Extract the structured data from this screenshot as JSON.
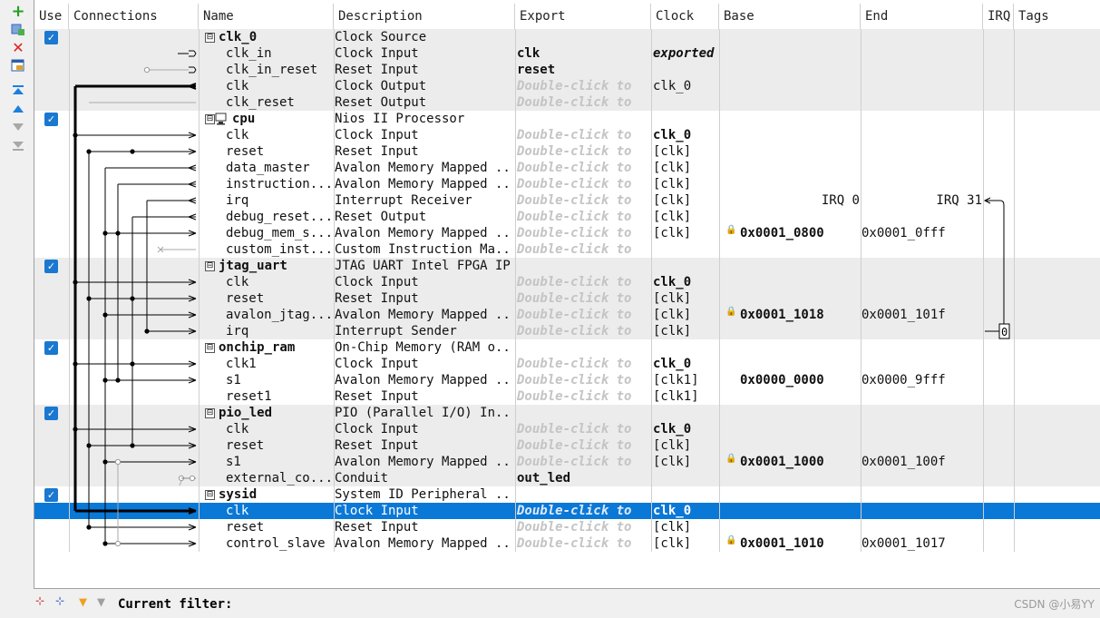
{
  "columns": [
    "Use",
    "Connections",
    "Name",
    "Description",
    "Export",
    "Clock",
    "Base",
    "End",
    "IRQ",
    "Tags"
  ],
  "rows": [
    {
      "kind": "comp",
      "use": true,
      "tree": "⊟",
      "name": "clk_0",
      "desc": "Clock Source",
      "export": "",
      "exportStyle": "",
      "clock": "",
      "clockBold": false,
      "base": "",
      "end": ""
    },
    {
      "kind": "iface",
      "name": "clk_in",
      "desc": "Clock Input",
      "export": "clk",
      "exportStyle": "bold",
      "clock": "exported",
      "clockBold": true,
      "clockItalic": true,
      "base": "",
      "end": ""
    },
    {
      "kind": "iface",
      "name": "clk_in_reset",
      "desc": "Reset Input",
      "export": "reset",
      "exportStyle": "bold",
      "clock": "",
      "clockBold": false,
      "base": "",
      "end": ""
    },
    {
      "kind": "iface",
      "name": "clk",
      "desc": "Clock Output",
      "export": "Double-click to",
      "exportStyle": "hint",
      "clock": "clk_0",
      "clockBold": false,
      "base": "",
      "end": ""
    },
    {
      "kind": "iface",
      "name": "clk_reset",
      "desc": "Reset Output",
      "export": "Double-click to",
      "exportStyle": "hint",
      "clock": "",
      "clockBold": false,
      "base": "",
      "end": ""
    },
    {
      "kind": "comp",
      "use": true,
      "tree": "⊟",
      "icon": true,
      "name": "cpu",
      "desc": "Nios II Processor",
      "export": "",
      "exportStyle": "",
      "clock": "",
      "clockBold": false,
      "base": "",
      "end": ""
    },
    {
      "kind": "iface",
      "name": "clk",
      "desc": "Clock Input",
      "export": "Double-click to",
      "exportStyle": "hint",
      "clock": "clk_0",
      "clockBold": true,
      "base": "",
      "end": ""
    },
    {
      "kind": "iface",
      "name": "reset",
      "desc": "Reset Input",
      "export": "Double-click to",
      "exportStyle": "hint",
      "clock": "[clk]",
      "clockBold": false,
      "base": "",
      "end": ""
    },
    {
      "kind": "iface",
      "name": "data_master",
      "desc": "Avalon Memory Mapped ...",
      "export": "Double-click to",
      "exportStyle": "hint",
      "clock": "[clk]",
      "clockBold": false,
      "base": "",
      "end": ""
    },
    {
      "kind": "iface",
      "name": "instruction...",
      "desc": "Avalon Memory Mapped ...",
      "export": "Double-click to",
      "exportStyle": "hint",
      "clock": "[clk]",
      "clockBold": false,
      "base": "",
      "end": ""
    },
    {
      "kind": "iface",
      "name": "irq",
      "desc": "Interrupt Receiver",
      "export": "Double-click to",
      "exportStyle": "hint",
      "clock": "[clk]",
      "clockBold": false,
      "base": "IRQ 0",
      "baseRight": true,
      "end": "IRQ 31",
      "endRight": true
    },
    {
      "kind": "iface",
      "name": "debug_reset...",
      "desc": "Reset Output",
      "export": "Double-click to",
      "exportStyle": "hint",
      "clock": "[clk]",
      "clockBold": false,
      "base": "",
      "end": ""
    },
    {
      "kind": "iface",
      "name": "debug_mem_s...",
      "desc": "Avalon Memory Mapped ...",
      "export": "Double-click to",
      "exportStyle": "hint",
      "clock": "[clk]",
      "clockBold": false,
      "base": "0x0001_0800",
      "end": "0x0001_0fff",
      "lock": true
    },
    {
      "kind": "iface",
      "name": "custom_inst...",
      "desc": "Custom Instruction Ma...",
      "export": "Double-click to",
      "exportStyle": "hint",
      "clock": "",
      "clockBold": false,
      "base": "",
      "end": ""
    },
    {
      "kind": "comp",
      "use": true,
      "tree": "⊟",
      "name": "jtag_uart",
      "desc": "JTAG UART Intel FPGA IP",
      "export": "",
      "exportStyle": "",
      "clock": "",
      "clockBold": false,
      "base": "",
      "end": ""
    },
    {
      "kind": "iface",
      "name": "clk",
      "desc": "Clock Input",
      "export": "Double-click to",
      "exportStyle": "hint",
      "clock": "clk_0",
      "clockBold": true,
      "base": "",
      "end": ""
    },
    {
      "kind": "iface",
      "name": "reset",
      "desc": "Reset Input",
      "export": "Double-click to",
      "exportStyle": "hint",
      "clock": "[clk]",
      "clockBold": false,
      "base": "",
      "end": ""
    },
    {
      "kind": "iface",
      "name": "avalon_jtag...",
      "desc": "Avalon Memory Mapped ...",
      "export": "Double-click to",
      "exportStyle": "hint",
      "clock": "[clk]",
      "clockBold": false,
      "base": "0x0001_1018",
      "end": "0x0001_101f",
      "lock": true
    },
    {
      "kind": "iface",
      "name": "irq",
      "desc": "Interrupt Sender",
      "export": "Double-click to",
      "exportStyle": "hint",
      "clock": "[clk]",
      "clockBold": false,
      "base": "",
      "end": ""
    },
    {
      "kind": "comp",
      "use": true,
      "tree": "⊟",
      "name": "onchip_ram",
      "desc": "On-Chip Memory (RAM o...",
      "export": "",
      "exportStyle": "",
      "clock": "",
      "clockBold": false,
      "base": "",
      "end": ""
    },
    {
      "kind": "iface",
      "name": "clk1",
      "desc": "Clock Input",
      "export": "Double-click to",
      "exportStyle": "hint",
      "clock": "clk_0",
      "clockBold": true,
      "base": "",
      "end": ""
    },
    {
      "kind": "iface",
      "name": "s1",
      "desc": "Avalon Memory Mapped ...",
      "export": "Double-click to",
      "exportStyle": "hint",
      "clock": "[clk1]",
      "clockBold": false,
      "base": "0x0000_0000",
      "end": "0x0000_9fff",
      "lock": false
    },
    {
      "kind": "iface",
      "name": "reset1",
      "desc": "Reset Input",
      "export": "Double-click to",
      "exportStyle": "hint",
      "clock": "[clk1]",
      "clockBold": false,
      "base": "",
      "end": ""
    },
    {
      "kind": "comp",
      "use": true,
      "tree": "⊟",
      "name": "pio_led",
      "desc": "PIO (Parallel I/O) In...",
      "export": "",
      "exportStyle": "",
      "clock": "",
      "clockBold": false,
      "base": "",
      "end": ""
    },
    {
      "kind": "iface",
      "name": "clk",
      "desc": "Clock Input",
      "export": "Double-click to",
      "exportStyle": "hint",
      "clock": "clk_0",
      "clockBold": true,
      "base": "",
      "end": ""
    },
    {
      "kind": "iface",
      "name": "reset",
      "desc": "Reset Input",
      "export": "Double-click to",
      "exportStyle": "hint",
      "clock": "[clk]",
      "clockBold": false,
      "base": "",
      "end": ""
    },
    {
      "kind": "iface",
      "name": "s1",
      "desc": "Avalon Memory Mapped ...",
      "export": "Double-click to",
      "exportStyle": "hint",
      "clock": "[clk]",
      "clockBold": false,
      "base": "0x0001_1000",
      "end": "0x0001_100f",
      "lock": true
    },
    {
      "kind": "iface",
      "name": "external_co...",
      "desc": "Conduit",
      "export": "out_led",
      "exportStyle": "bold",
      "clock": "",
      "clockBold": false,
      "base": "",
      "end": ""
    },
    {
      "kind": "comp",
      "use": true,
      "tree": "⊟",
      "name": "sysid",
      "desc": "System ID Peripheral ...",
      "export": "",
      "exportStyle": "",
      "clock": "",
      "clockBold": false,
      "base": "",
      "end": ""
    },
    {
      "kind": "iface",
      "selected": true,
      "name": "clk",
      "desc": "Clock Input",
      "export": "Double-click to",
      "exportStyle": "hint",
      "clock": "clk_0",
      "clockBold": true,
      "base": "",
      "end": ""
    },
    {
      "kind": "iface",
      "name": "reset",
      "desc": "Reset Input",
      "export": "Double-click to",
      "exportStyle": "hint",
      "clock": "[clk]",
      "clockBold": false,
      "base": "",
      "end": ""
    },
    {
      "kind": "iface",
      "name": "control_slave",
      "desc": "Avalon Memory Mapped ...",
      "export": "Double-click to",
      "exportStyle": "hint",
      "clock": "[clk]",
      "clockBold": false,
      "base": "0x0001_1010",
      "end": "0x0001_1017",
      "lock": true
    }
  ],
  "irq_value": "0",
  "status": {
    "filter_label": "Current filter:"
  },
  "watermark": "CSDN @小易YY",
  "colors": {
    "selection": "#0a78d7",
    "checkbox": "#1a78d0",
    "group_bg": "#ececec"
  }
}
